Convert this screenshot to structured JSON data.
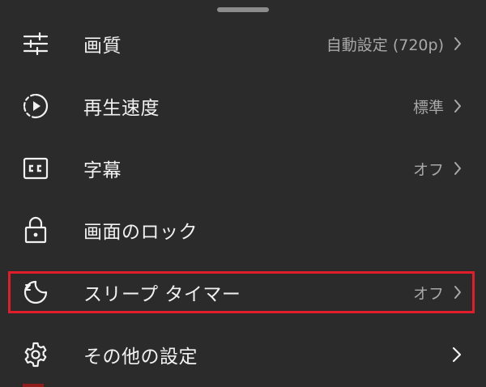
{
  "settings": {
    "items": [
      {
        "label": "画質",
        "value": "自動設定 (720p)",
        "icon": "tune-sliders-icon"
      },
      {
        "label": "再生速度",
        "value": "標準",
        "icon": "playback-speed-icon"
      },
      {
        "label": "字幕",
        "value": "オフ",
        "icon": "closed-captions-icon"
      },
      {
        "label": "画面のロック",
        "value": "",
        "icon": "lock-icon"
      },
      {
        "label": "スリープ タイマー",
        "value": "オフ",
        "icon": "sleep-timer-icon"
      },
      {
        "label": "その他の設定",
        "value": "",
        "icon": "gear-icon"
      }
    ]
  },
  "colors": {
    "background": "#2b2b2b",
    "text": "#f1f1f1",
    "value_text": "#a8a8a8",
    "highlight": "#e11d2b"
  }
}
